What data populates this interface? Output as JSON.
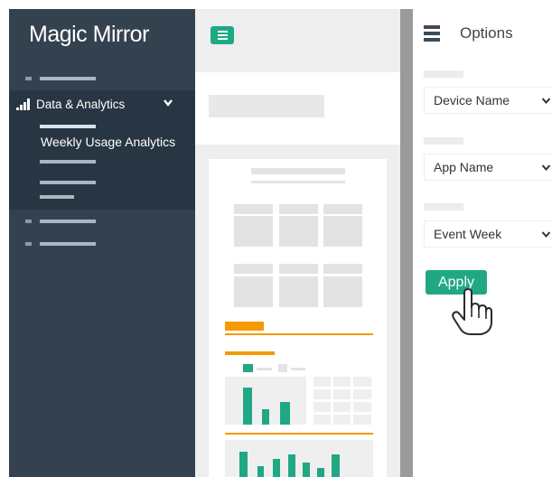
{
  "sidebar": {
    "brand": "Magic Mirror",
    "group_label": "Data & Analytics",
    "group_icon": "signal-bars-icon",
    "group_expand_icon": "chevron-down-icon",
    "active_item_label": "Weekly Usage Analytics"
  },
  "header": {
    "menu_icon": "hamburger-menu-icon"
  },
  "options": {
    "title": "Options",
    "title_icon": "options-list-icon",
    "filters": [
      {
        "value": "Device Name"
      },
      {
        "value": "App Name"
      },
      {
        "value": "Event Week"
      }
    ],
    "apply_label": "Apply",
    "cursor_icon": "hand-pointer-icon"
  },
  "colors": {
    "sidebar_bg": "#34414f",
    "submenu_bg": "#283542",
    "accent": "#20a885",
    "highlight": "#f59a00",
    "canvas_bg": "#eeeeee"
  }
}
